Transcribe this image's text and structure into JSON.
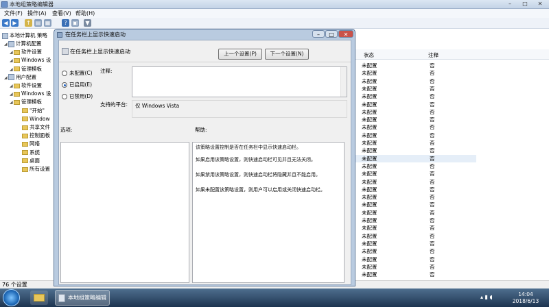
{
  "window": {
    "title": "本地组策略编辑器"
  },
  "menu": [
    "文件(F)",
    "操作(A)",
    "查看(V)",
    "帮助(H)"
  ],
  "tree": {
    "root": "本地计算机 策略",
    "items": [
      {
        "label": "计算机配置",
        "depth": 1,
        "icon": "computer-icon"
      },
      {
        "label": "软件设置",
        "depth": 2,
        "icon": "folder-icon"
      },
      {
        "label": "Windows 设",
        "depth": 2,
        "icon": "folder-icon"
      },
      {
        "label": "管理模板",
        "depth": 2,
        "icon": "folder-icon"
      },
      {
        "label": "用户配置",
        "depth": 1,
        "icon": "user-icon"
      },
      {
        "label": "软件设置",
        "depth": 2,
        "icon": "folder-icon"
      },
      {
        "label": "Windows 设",
        "depth": 2,
        "icon": "folder-icon"
      },
      {
        "label": "管理模板",
        "depth": 2,
        "icon": "folder-icon"
      },
      {
        "label": "\"开始\"",
        "depth": 3,
        "icon": "folder-icon"
      },
      {
        "label": "Window",
        "depth": 3,
        "icon": "folder-icon"
      },
      {
        "label": "共享文件",
        "depth": 3,
        "icon": "folder-icon"
      },
      {
        "label": "控制面板",
        "depth": 3,
        "icon": "folder-icon"
      },
      {
        "label": "网络",
        "depth": 3,
        "icon": "folder-icon"
      },
      {
        "label": "系统",
        "depth": 3,
        "icon": "folder-icon"
      },
      {
        "label": "桌面",
        "depth": 3,
        "icon": "folder-icon"
      },
      {
        "label": "所有设置",
        "depth": 3,
        "icon": "folder-icon"
      }
    ]
  },
  "list": {
    "headers": [
      "状态",
      "注释"
    ],
    "rows": [
      {
        "state": "未配置",
        "comment": "否"
      },
      {
        "state": "未配置",
        "comment": "否"
      },
      {
        "state": "未配置",
        "comment": "否"
      },
      {
        "state": "未配置",
        "comment": "否"
      },
      {
        "state": "未配置",
        "comment": "否"
      },
      {
        "state": "未配置",
        "comment": "否"
      },
      {
        "state": "未配置",
        "comment": "否"
      },
      {
        "state": "未配置",
        "comment": "否"
      },
      {
        "state": "未配置",
        "comment": "否"
      },
      {
        "state": "未配置",
        "comment": "否"
      },
      {
        "state": "未配置",
        "comment": "否"
      },
      {
        "state": "未配置",
        "comment": "否"
      },
      {
        "state": "未配置",
        "comment": "否"
      },
      {
        "state": "未配置",
        "comment": "否"
      },
      {
        "state": "未配置",
        "comment": "否"
      },
      {
        "state": "未配置",
        "comment": "否"
      },
      {
        "state": "未配置",
        "comment": "否"
      },
      {
        "state": "未配置",
        "comment": "否"
      },
      {
        "state": "未配置",
        "comment": "否"
      },
      {
        "state": "未配置",
        "comment": "否"
      },
      {
        "state": "未配置",
        "comment": "否"
      },
      {
        "state": "未配置",
        "comment": "否"
      },
      {
        "state": "未配置",
        "comment": "否"
      },
      {
        "state": "未配置",
        "comment": "否"
      },
      {
        "state": "未配置",
        "comment": "否"
      },
      {
        "state": "未配置",
        "comment": "否"
      },
      {
        "state": "未配置",
        "comment": "否"
      },
      {
        "state": "未配置",
        "comment": "否"
      }
    ]
  },
  "status": {
    "count": "76 个设置"
  },
  "dialog": {
    "title": "在任务栏上显示快速启动",
    "header_title": "在任务栏上显示快速启动",
    "prev_button": "上一个设置(P)",
    "next_button": "下一个设置(N)",
    "radios": [
      {
        "label": "未配置(C)",
        "checked": false
      },
      {
        "label": "已启用(E)",
        "checked": true
      },
      {
        "label": "已禁用(D)",
        "checked": false
      }
    ],
    "comment_label": "注释:",
    "comment_value": "",
    "platform_label": "支持的平台:",
    "platform_value": "仅 Windows Vista",
    "options_label": "选项:",
    "help_label": "帮助:",
    "help_lines": [
      "该策略设置控制是否在任务栏中显示快速启动栏。",
      "如果启用该策略设置，则快速启动栏可见并且无法关闭。",
      "如果禁用该策略设置，则快速启动栏将隐藏并且不能启用。",
      "如果未配置该策略设置，则用户可以启用或关闭快速启动栏。"
    ]
  },
  "taskbar": {
    "task_label": "本地组策略编辑器",
    "time": "14:04",
    "date": "2018/6/13"
  }
}
